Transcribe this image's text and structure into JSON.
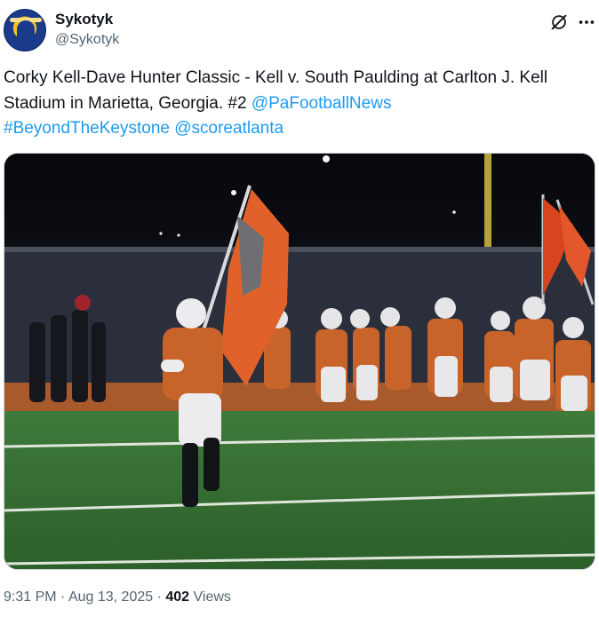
{
  "author": {
    "display_name": "Sykotyk",
    "handle": "@Sykotyk",
    "avatar_icon": "team-logo-avatar"
  },
  "tweet": {
    "text_plain": "Corky Kell-Dave Hunter Classic - Kell v. South Paulding at Carlton J. Kell Stadium in Marietta, Georgia. #2 ",
    "mention_1": "@PaFootballNews",
    "hashtag_1": "#BeyondTheKeystone",
    "mention_2": "@scoreatlanta",
    "media_alt": "football-team-taking-field-with-flags"
  },
  "meta": {
    "time": "9:31 PM",
    "separator": "·",
    "date": "Aug 13, 2025",
    "views_count": "402",
    "views_label": "Views"
  },
  "colors": {
    "link": "#1d9bf0",
    "secondary_text": "#536471",
    "jersey_orange": "#c8632a"
  }
}
